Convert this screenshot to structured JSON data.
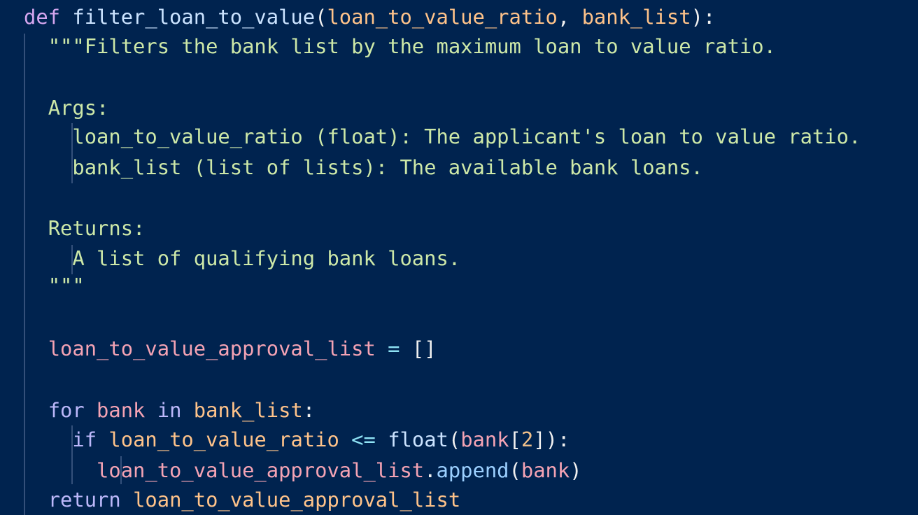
{
  "code": {
    "def_kw": "def",
    "func_name": "filter_loan_to_value",
    "param1": "loan_to_value_ratio",
    "param2": "bank_list",
    "open_paren": "(",
    "comma": ", ",
    "close_sig": "):",
    "doc_line1": "\"\"\"Filters the bank list by the maximum loan to value ratio.",
    "doc_args": "Args:",
    "doc_arg1": "loan_to_value_ratio (float): The applicant's loan to value ratio.",
    "doc_arg2": "bank_list (list of lists): The available bank loans.",
    "doc_returns": "Returns:",
    "doc_ret1": "A list of qualifying bank loans.",
    "doc_end": "\"\"\"",
    "approval_var": "loan_to_value_approval_list",
    "assign_op": " = ",
    "empty_list": "[]",
    "for_kw": "for",
    "loop_var": "bank",
    "in_kw": "in",
    "iter_var": "bank_list",
    "colon": ":",
    "if_kw": "if",
    "cmp_var": "loan_to_value_ratio",
    "cmp_op": "<=",
    "float_fn": "float",
    "index_open": "[",
    "index_num": "2",
    "index_close_if": "]):",
    "append_target": "loan_to_value_approval_list",
    "dot": ".",
    "append_fn": "append",
    "append_arg": "bank",
    "close_paren": ")",
    "return_kw": "return",
    "return_var": "loan_to_value_approval_list"
  },
  "colors": {
    "background": "#00234f",
    "keyword_def": "#d6a7f0",
    "keyword": "#bcb8fa",
    "function": "#cbe3ff",
    "parameter": "#ffc38a",
    "variable": "#f4a3b4",
    "string": "#cde8a8",
    "operator": "#8fe3f5"
  }
}
